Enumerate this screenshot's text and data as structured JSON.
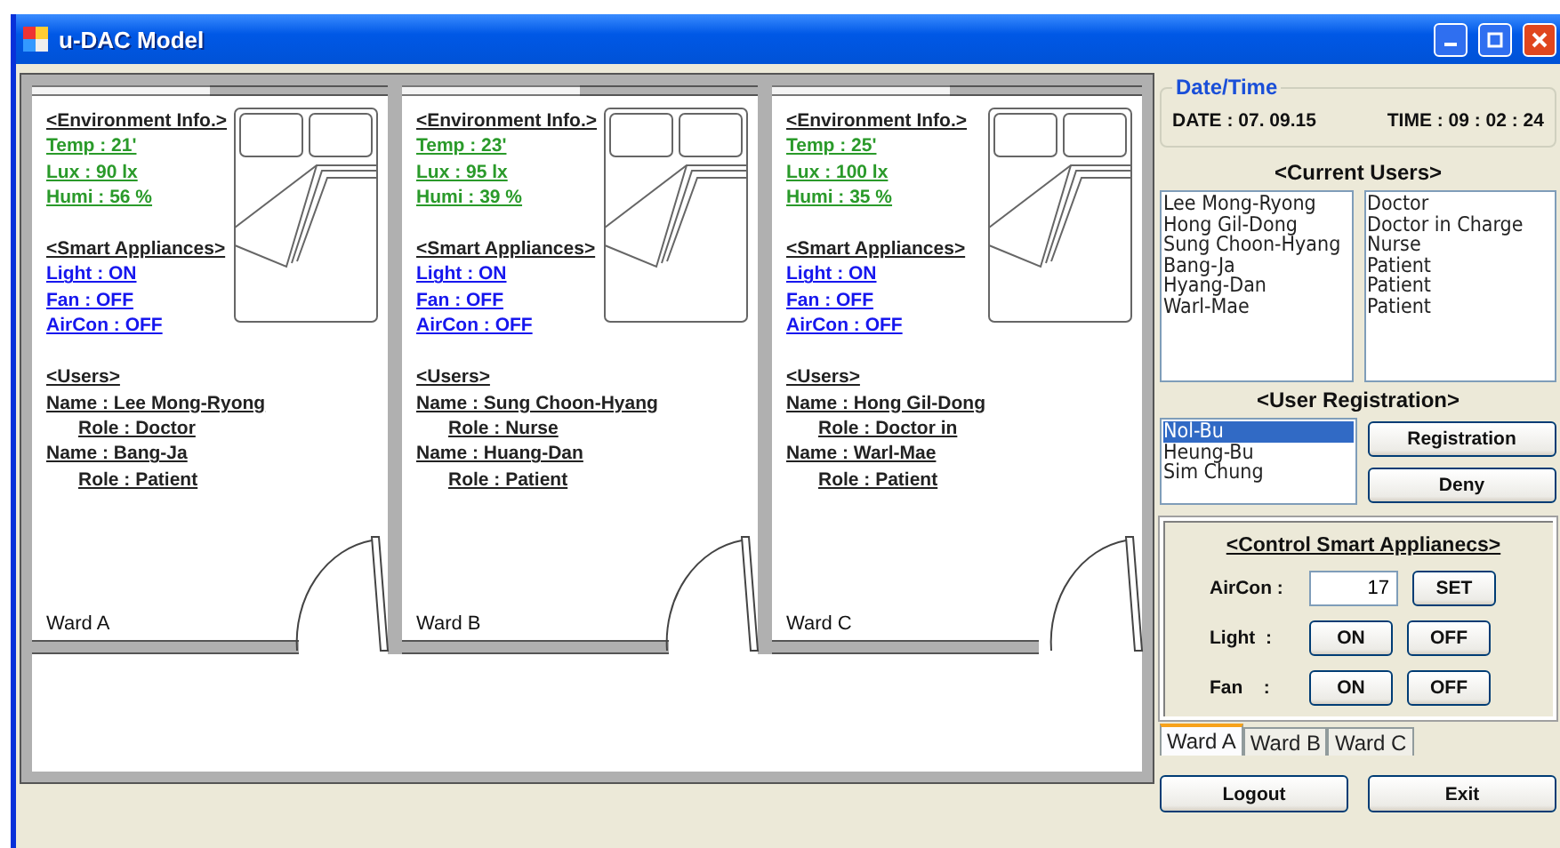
{
  "window": {
    "title": "u-DAC Model"
  },
  "wards": [
    {
      "name": "Ward A",
      "environment_heading": "<Environment Info.>",
      "environment": [
        "Temp : 21'",
        "Lux : 90 lx",
        "Humi : 56 %"
      ],
      "appliances_heading": "<Smart Appliances>",
      "appliances": [
        "Light : ON",
        "Fan : OFF",
        "AirCon : OFF"
      ],
      "users_heading": "<Users>",
      "users": [
        {
          "name": "Name : Lee Mong-Ryong",
          "role": "Role : Doctor"
        },
        {
          "name": "Name : Bang-Ja",
          "role": "Role : Patient"
        }
      ]
    },
    {
      "name": "Ward B",
      "environment_heading": "<Environment Info.>",
      "environment": [
        "Temp : 23'",
        "Lux : 95 lx",
        "Humi : 39 %"
      ],
      "appliances_heading": "<Smart Appliances>",
      "appliances": [
        "Light : ON",
        "Fan : OFF",
        "AirCon : OFF"
      ],
      "users_heading": "<Users>",
      "users": [
        {
          "name": "Name : Sung Choon-Hyang",
          "role": "Role : Nurse"
        },
        {
          "name": "Name : Huang-Dan",
          "role": "Role : Patient"
        }
      ]
    },
    {
      "name": "Ward C",
      "environment_heading": "<Environment Info.>",
      "environment": [
        "Temp : 25'",
        "Lux : 100 lx",
        "Humi : 35 %"
      ],
      "appliances_heading": "<Smart Appliances>",
      "appliances": [
        "Light : ON",
        "Fan : OFF",
        "AirCon : OFF"
      ],
      "users_heading": "<Users>",
      "users": [
        {
          "name": "Name : Hong Gil-Dong",
          "role": "Role : Doctor in "
        },
        {
          "name": "Name : Warl-Mae",
          "role": "Role : Patient"
        }
      ]
    }
  ],
  "date_time": {
    "title": "Date/Time",
    "date": "DATE : 07. 09.15",
    "time": "TIME : 09 : 02 : 24"
  },
  "current_users": {
    "heading": "<Current Users>",
    "names": [
      "Lee Mong-Ryong",
      "Hong Gil-Dong",
      "Sung Choon-Hyang",
      "Bang-Ja",
      "Hyang-Dan",
      "Warl-Mae"
    ],
    "roles": [
      "Doctor",
      "Doctor in Charge",
      "Nurse",
      "Patient",
      "Patient",
      "Patient"
    ]
  },
  "user_registration": {
    "heading": "<User Registration>",
    "items": [
      {
        "label": "Nol-Bu",
        "selected": true
      },
      {
        "label": "Heung-Bu",
        "selected": false
      },
      {
        "label": "Sim Chung",
        "selected": false
      }
    ],
    "buttons": [
      "Registration",
      "Deny"
    ]
  },
  "control": {
    "heading": "<Control Smart Applianecs>",
    "rows": [
      {
        "kind": "field",
        "label": "AirCon :",
        "value": "17",
        "buttons": [
          "SET"
        ]
      },
      {
        "kind": "toggle",
        "label": "Light  :",
        "buttons": [
          "ON",
          "OFF"
        ]
      },
      {
        "kind": "toggle",
        "label": "Fan    :",
        "buttons": [
          "ON",
          "OFF"
        ]
      }
    ]
  },
  "tabs": [
    {
      "label": "Ward A",
      "selected": true
    },
    {
      "label": "Ward B",
      "selected": false
    },
    {
      "label": "Ward C",
      "selected": false
    }
  ],
  "buttons": [
    "Logout",
    "Exit"
  ]
}
